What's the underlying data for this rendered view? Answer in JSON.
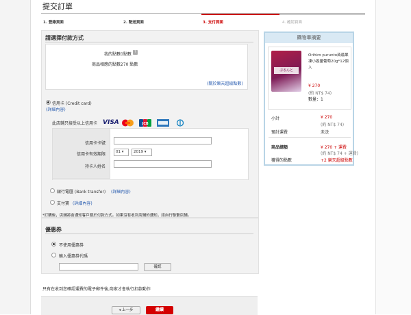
{
  "page": {
    "title": "提交訂單"
  },
  "steps": [
    {
      "label": "1. 登錄頁面"
    },
    {
      "label": "2. 配送頁面"
    },
    {
      "label": "3. 支付頁面"
    },
    {
      "label": "4. 確認頁面"
    }
  ],
  "payment": {
    "heading": "請選擇付款方式",
    "points_row1_label": "我的點數",
    "points_row1_value": "0點數",
    "points_row2_label": "商品相應的點數",
    "points_row2_value": "270 點數",
    "points_link": "(關於樂天超級點數)",
    "credit_label": "信用卡 (Credit card)",
    "credit_detail": "(詳細內容)",
    "accepted_text": "此店鋪只接受以上信用卡",
    "cards": [
      "VISA",
      "MasterCard",
      "JCB",
      "AMERICAN EXPRESS",
      "Diners Club"
    ],
    "card_number_label": "信用卡卡號",
    "expiry_label": "信用卡有效期限",
    "expiry_month": "01",
    "expiry_year": "2019",
    "holder_label": "持卡人姓名",
    "bank_label": "銀行電匯 (Bank transfer)",
    "bank_detail": "(詳細內容)",
    "alipay_label": "支付寶",
    "alipay_detail": "(詳細內容)",
    "note": "*訂購後，店鋪將會通知客戶關於付款方式。如果沒有收到店鋪的通知，請自行聯繫店鋪。"
  },
  "coupon": {
    "heading": "優惠券",
    "opt_none": "不使用優惠券",
    "opt_enter": "輸入優惠券代碼",
    "confirm": "確認"
  },
  "notice": "只有在收到您確認運費的電子郵件後,商家才會執行扣款動作",
  "footer": {
    "back": "上一步",
    "next": "繼續"
  },
  "cart": {
    "heading": "購物車摘要",
    "product_name": "Orihiro puruntо蒟蒻果凍小容量葡萄20g*12個入",
    "price": "¥ 270",
    "price_sub": "(約 NT$ 74)",
    "qty": "數量：1",
    "subtotal_label": "小計",
    "subtotal_value": "¥ 270",
    "subtotal_sub": "(約 NT$ 74)",
    "shipping_label": "預計運費",
    "shipping_value": "未決",
    "total_label": "商品總額",
    "total_value": "¥ 270 + 運費",
    "total_sub": "(約 NT$ 74 + 運費)",
    "points_label": "獲得的點數",
    "points_value": "+2 樂天超級點數",
    "product_thumb_text": "ぷるんと"
  },
  "colors": {
    "accent": "#cc0000",
    "link": "#2a5db0",
    "cart_border": "#b8d4e6",
    "cart_header": "#d9e9f4"
  }
}
